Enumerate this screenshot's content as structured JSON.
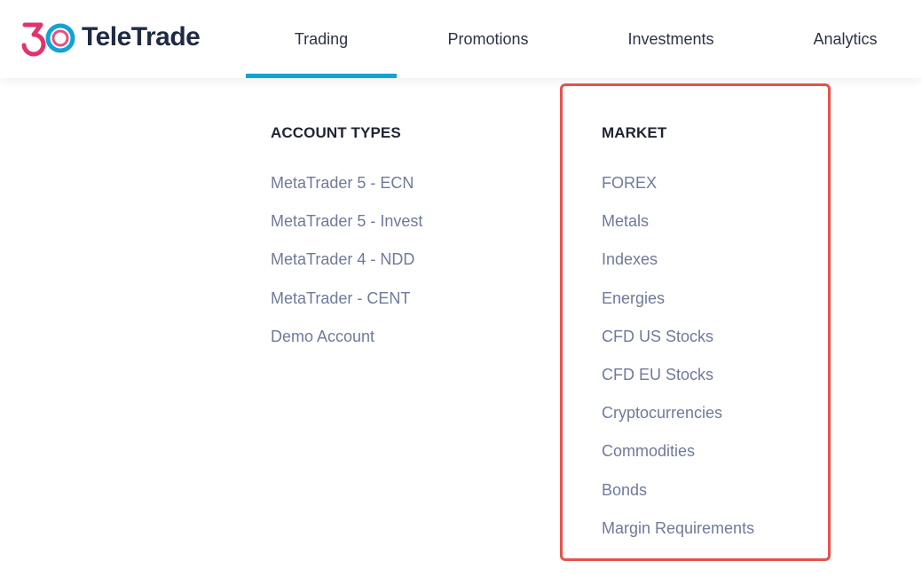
{
  "brand": {
    "logo_text": "TeleTrade",
    "logo_badge": "30",
    "colors": {
      "blue": "#12a3d2",
      "pink": "#e2336b",
      "navy": "#1f2a44"
    }
  },
  "nav": {
    "items": [
      {
        "label": "Trading",
        "active": true
      },
      {
        "label": "Promotions",
        "active": false
      },
      {
        "label": "Investments",
        "active": false
      },
      {
        "label": "Analytics",
        "active": false
      }
    ]
  },
  "menu": {
    "account_types": {
      "heading": "ACCOUNT TYPES",
      "items": [
        "MetaTrader 5 - ECN",
        "MetaTrader 5 - Invest",
        "MetaTrader 4 - NDD",
        "MetaTrader - CENT",
        "Demo Account"
      ]
    },
    "market": {
      "heading": "MARKET",
      "items": [
        "FOREX",
        "Metals",
        "Indexes",
        "Energies",
        "CFD US Stocks",
        "CFD EU Stocks",
        "Cryptocurrencies",
        "Commodities",
        "Bonds",
        "Margin Requirements"
      ]
    }
  },
  "highlight": {
    "color": "#e5534b"
  }
}
